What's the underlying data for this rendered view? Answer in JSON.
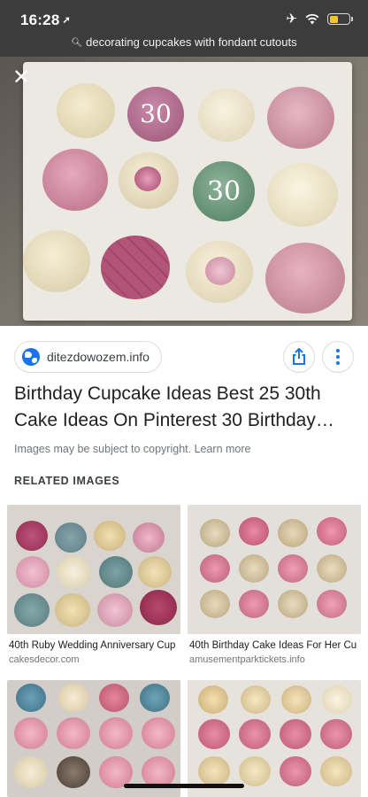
{
  "status_bar": {
    "time": "16:28",
    "icons": [
      "location-arrow-icon",
      "airplane-icon",
      "wifi-icon",
      "battery-icon"
    ],
    "battery_level": 0.45,
    "battery_color": "#f4c430"
  },
  "search": {
    "query": "decorating cupcakes with fondant cutouts"
  },
  "result": {
    "source": "ditezdowozem.info",
    "title": "Birthday Cupcake Ideas Best 25 30th Cake Ideas On Pinterest 30 Birthday…",
    "copyright": "Images may be subject to copyright. Learn more"
  },
  "related": {
    "heading": "RELATED IMAGES",
    "items": [
      {
        "caption": "40th Ruby Wedding Anniversary Cup…",
        "domain": "cakesdecor.com"
      },
      {
        "caption": "40th Birthday Cake Ideas For Her Cu…",
        "domain": "amusementparktickets.info"
      },
      {
        "caption": "",
        "domain": ""
      },
      {
        "caption": "",
        "domain": ""
      }
    ]
  },
  "colors": {
    "accent": "#1a73e8",
    "header_bg": "#3c3c3c"
  }
}
